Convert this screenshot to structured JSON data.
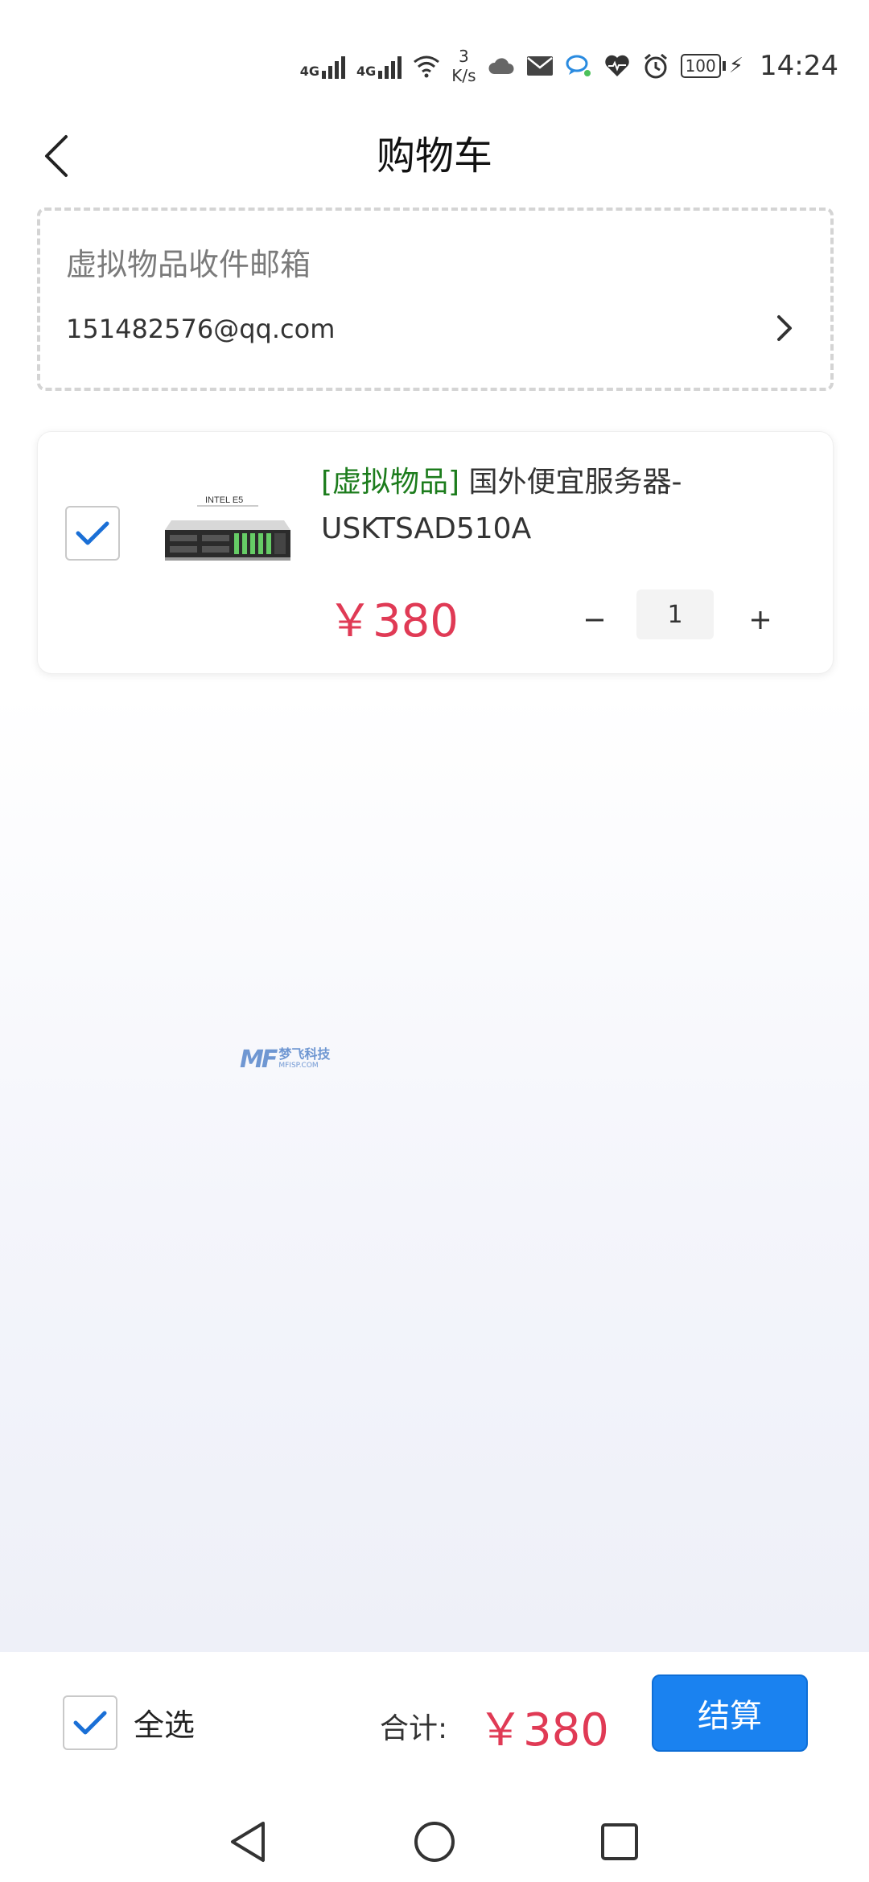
{
  "status_bar": {
    "net1": "4G",
    "net2": "4G",
    "net_speed_value": "3",
    "net_speed_unit": "K/s",
    "battery": "100",
    "time": "14:24"
  },
  "header": {
    "title": "购物车"
  },
  "email_section": {
    "label": "虚拟物品收件邮箱",
    "email": "151482576@qq.com"
  },
  "cart_item": {
    "tag": "[虚拟物品]",
    "title": " 国外便宜服务器-USKTSAD510A",
    "image_label": "INTEL E5",
    "price": "￥380",
    "quantity": "1",
    "checked": true
  },
  "watermark": {
    "logo": "MF",
    "cn": "梦飞科技",
    "en": "MFISP.COM"
  },
  "footer": {
    "select_all_label": "全选",
    "total_label": "合计:",
    "total_price": "￥380",
    "checkout_label": "结算"
  },
  "colors": {
    "accent": "#1a82f0",
    "price": "#e03a55",
    "tag": "#1c7c1c"
  }
}
